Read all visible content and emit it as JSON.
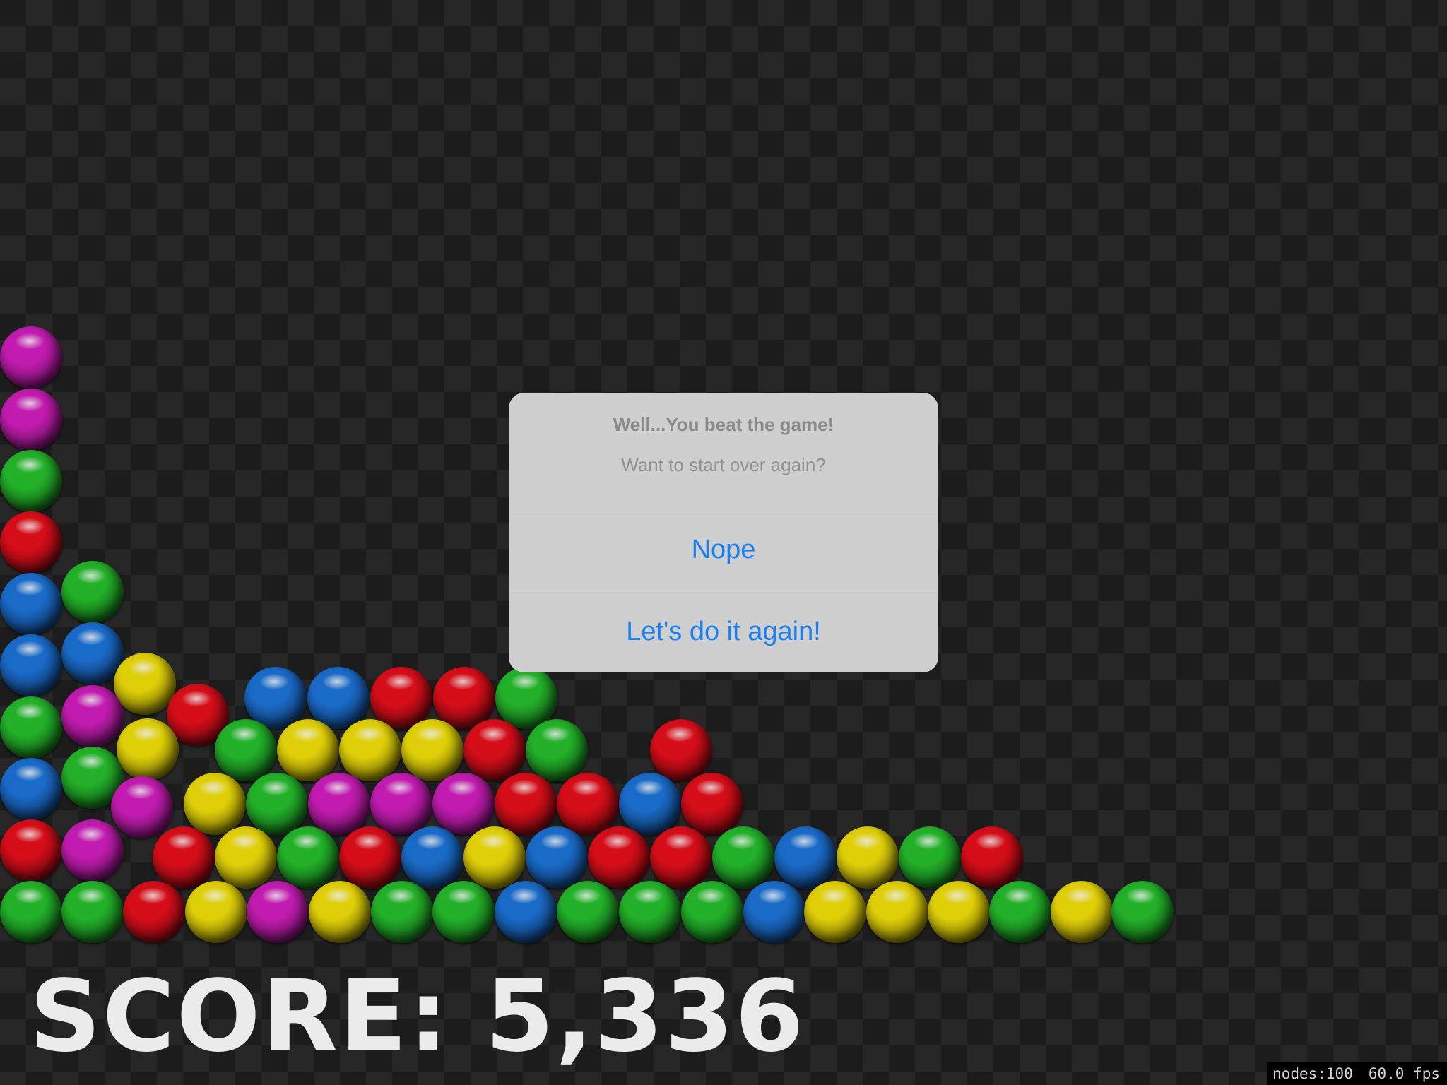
{
  "score": {
    "text": "SCORE: 5,336"
  },
  "stats": {
    "nodes": "nodes:100",
    "fps": "60.0 fps"
  },
  "alert": {
    "title": "Well...You beat the game!",
    "message": "Want to start over again?",
    "buttons": [
      "Nope",
      "Let's do it again!"
    ]
  },
  "colors": {
    "magenta": "#d21fbe",
    "green": "#26c02d",
    "red": "#e8101c",
    "blue": "#1d74d9",
    "yellow": "#f2e10a",
    "alert_button_text": "#1a7ff0"
  },
  "balls": [
    "magenta",
    "magenta",
    "green",
    "red",
    "blue",
    "green",
    "blue",
    "blue",
    "yellow",
    "green",
    "magenta",
    "red",
    "blue",
    "blue",
    "red",
    "red",
    "green",
    "blue",
    "yellow",
    "green",
    "yellow",
    "yellow",
    "yellow",
    "red",
    "green",
    "red",
    "green",
    "magenta",
    "yellow",
    "green",
    "magenta",
    "magenta",
    "magenta",
    "red",
    "red",
    "blue",
    "red",
    "red",
    "magenta",
    "red",
    "yellow",
    "green",
    "red",
    "blue",
    "yellow",
    "blue",
    "red",
    "red",
    "green",
    "blue",
    "yellow",
    "green",
    "red",
    "green",
    "green",
    "red",
    "yellow",
    "magenta",
    "yellow",
    "green",
    "green",
    "blue",
    "green",
    "green",
    "green",
    "blue",
    "yellow",
    "yellow",
    "yellow",
    "green",
    "yellow",
    "green"
  ]
}
